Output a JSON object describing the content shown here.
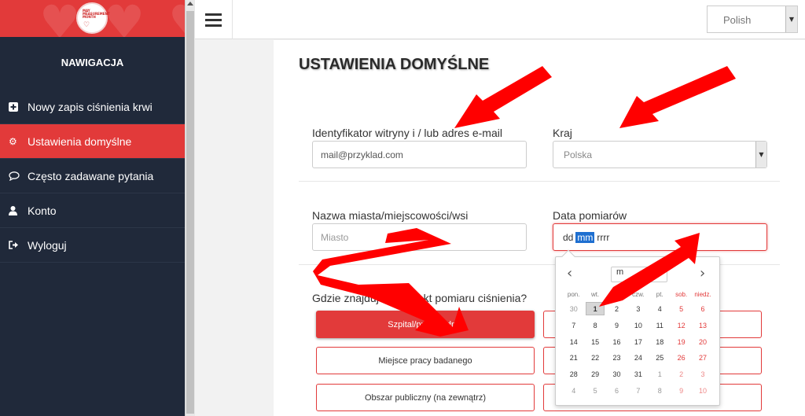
{
  "sidebar": {
    "logo_text": "MAY MEASUREMENT MONTH",
    "title": "NAWIGACJA",
    "items": [
      {
        "label": "Nowy zapis ciśnienia krwi",
        "icon": "plus-square-icon",
        "active": false
      },
      {
        "label": "Ustawienia domyślne",
        "icon": "gear-icon",
        "active": true
      },
      {
        "label": "Często zadawane pytania",
        "icon": "speech-bubble-icon",
        "active": false
      },
      {
        "label": "Konto",
        "icon": "user-icon",
        "active": false
      },
      {
        "label": "Wyloguj",
        "icon": "sign-out-icon",
        "active": false
      }
    ]
  },
  "topbar": {
    "language": "Polish"
  },
  "page": {
    "title": "USTAWIENIA DOMYŚLNE",
    "site_id_label": "Identyfikator witryny i / lub adres e-mail",
    "site_id_value": "mail@przyklad.com",
    "country_label": "Kraj",
    "country_value": "Polska",
    "city_label": "Nazwa miasta/miejscowości/wsi",
    "city_placeholder": "Miasto",
    "date_label": "Data pomiarów",
    "date_dd": "dd",
    "date_mm": "mm",
    "date_rrrr": "rrrr",
    "location_question": "Gdzie znajduje się punkt pomiaru ciśnienia?",
    "options_left": [
      {
        "label": "Szpital/przychodnia",
        "active": true
      },
      {
        "label": "Miejsce pracy badanego",
        "active": false
      },
      {
        "label": "Obszar publiczny (na zewnątrz)",
        "active": false
      }
    ]
  },
  "datepicker": {
    "prev": "‹",
    "next": "›",
    "month": "m",
    "weekdays": [
      "pon.",
      "wt.",
      "śr.",
      "czw.",
      "pt.",
      "sob.",
      "niedz."
    ],
    "weeks": [
      [
        "30",
        "1",
        "2",
        "3",
        "4",
        "5",
        "6"
      ],
      [
        "7",
        "8",
        "9",
        "10",
        "11",
        "12",
        "13"
      ],
      [
        "14",
        "15",
        "16",
        "17",
        "18",
        "19",
        "20"
      ],
      [
        "21",
        "22",
        "23",
        "24",
        "25",
        "26",
        "27"
      ],
      [
        "28",
        "29",
        "30",
        "31",
        "1",
        "2",
        "3"
      ],
      [
        "4",
        "5",
        "6",
        "7",
        "8",
        "9",
        "10"
      ]
    ],
    "selected": "1"
  },
  "colors": {
    "accent": "#e23a3a",
    "sidebar_bg": "#20293a",
    "arrow": "#ff0000"
  }
}
